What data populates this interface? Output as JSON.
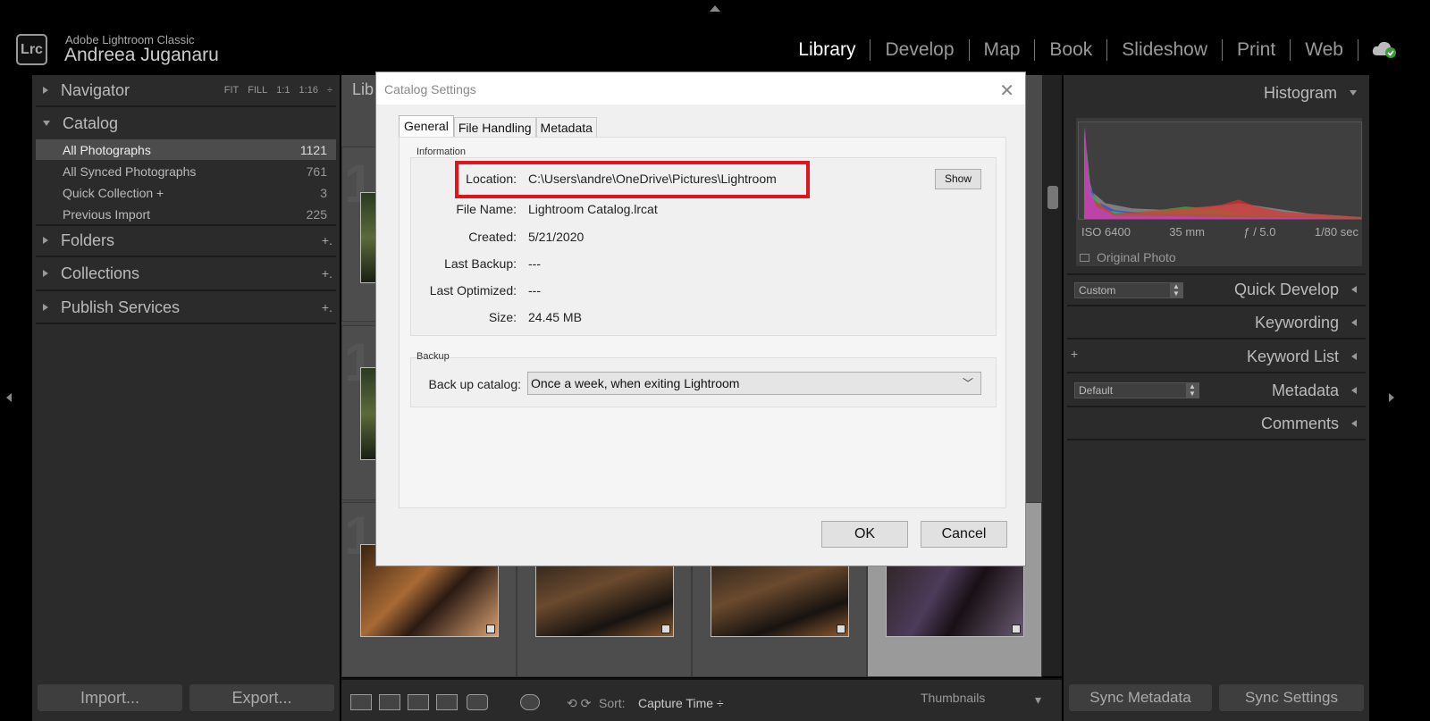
{
  "topbar": {
    "app_name": "Adobe Lightroom Classic",
    "user_name": "Andreea Juganaru",
    "logo_text": "Lrc",
    "modules": [
      "Library",
      "Develop",
      "Map",
      "Book",
      "Slideshow",
      "Print",
      "Web"
    ],
    "active_module": "Library"
  },
  "left_panel": {
    "navigator": {
      "title": "Navigator",
      "options": [
        "FIT",
        "FILL",
        "1:1",
        "1:16"
      ]
    },
    "catalog": {
      "title": "Catalog",
      "items": [
        {
          "label": "All Photographs",
          "count": "1121"
        },
        {
          "label": "All Synced Photographs",
          "count": "761"
        },
        {
          "label": "Quick Collection  +",
          "count": "3"
        },
        {
          "label": "Previous Import",
          "count": "225"
        }
      ]
    },
    "folders_title": "Folders",
    "collections_title": "Collections",
    "publish_title": "Publish Services",
    "plus": "+.",
    "import_label": "Import...",
    "export_label": "Export..."
  },
  "center": {
    "header_partial": "Lib",
    "toolbar": {
      "sort_label": "Sort:",
      "sort_value": "Capture Time ÷",
      "thumbnails_label": "Thumbnails"
    }
  },
  "right_panel": {
    "histogram": {
      "title": "Histogram",
      "iso": "ISO 6400",
      "focal": "35 mm",
      "aperture": "ƒ / 5.0",
      "shutter": "1/80 sec",
      "original_photo": "Original Photo"
    },
    "quick_develop": {
      "title": "Quick Develop",
      "preset": "Custom"
    },
    "keywording_title": "Keywording",
    "keyword_list_title": "Keyword List",
    "keyword_list_plus": "+",
    "metadata": {
      "title": "Metadata",
      "preset": "Default"
    },
    "comments_title": "Comments",
    "sync_metadata_label": "Sync Metadata",
    "sync_settings_label": "Sync Settings"
  },
  "dialog": {
    "title": "Catalog Settings",
    "close_glyph": "✕",
    "tabs": [
      "General",
      "File Handling",
      "Metadata"
    ],
    "active_tab": "General",
    "information": {
      "group_label": "Information",
      "location_label": "Location:",
      "location_value": "C:\\Users\\andre\\OneDrive\\Pictures\\Lightroom",
      "show_button": "Show",
      "file_name_label": "File Name:",
      "file_name_value": "Lightroom Catalog.lrcat",
      "created_label": "Created:",
      "created_value": "5/21/2020",
      "last_backup_label": "Last Backup:",
      "last_backup_value": "---",
      "last_optimized_label": "Last Optimized:",
      "last_optimized_value": "---",
      "size_label": "Size:",
      "size_value": "24.45 MB"
    },
    "backup": {
      "group_label": "Backup",
      "label": "Back up catalog:",
      "selected": "Once a week, when exiting Lightroom"
    },
    "ok_label": "OK",
    "cancel_label": "Cancel",
    "highlight_color": "#e0141c"
  }
}
